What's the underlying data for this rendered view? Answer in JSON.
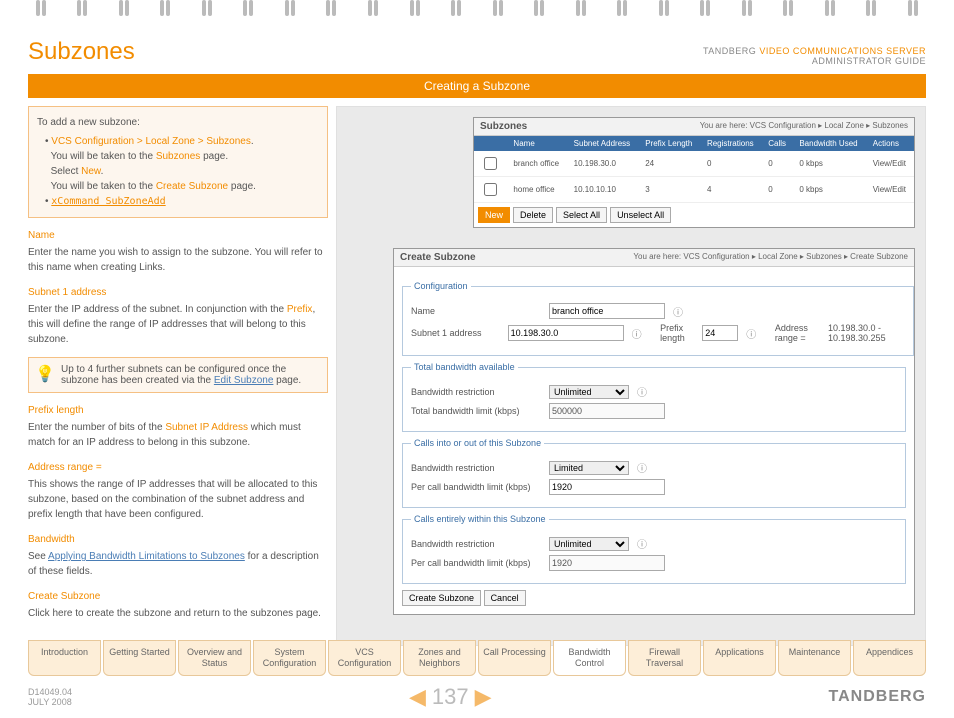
{
  "header": {
    "title": "Subzones",
    "brand": "TANDBERG",
    "product": "VIDEO COMMUNICATIONS SERVER",
    "guide": "ADMINISTRATOR GUIDE",
    "bar": "Creating a Subzone"
  },
  "intro": {
    "lead": "To add a new subzone:",
    "nav": "VCS Configuration > Local Zone > Subzones",
    "l1": "You will be taken to the ",
    "l1o": "Subzones",
    "l1b": " page.",
    "l2": "Select ",
    "l2o": "New",
    "l2b": ".",
    "l3": "You will be taken to the ",
    "l3o": "Create Subzone",
    "l3b": " page.",
    "cmd": "xCommand SubZoneAdd"
  },
  "name": {
    "t": "Name",
    "d": "Enter the name you wish to assign to the subzone.  You will refer to this name when creating Links."
  },
  "sub1": {
    "t": "Subnet 1 address",
    "d1": "Enter the IP address of the subnet.  In conjunction with the ",
    "link": "Prefix",
    "d2": ", this will define the range of IP addresses that will belong to this subzone."
  },
  "tip": {
    "d1": "Up to 4 further subnets can be configured once the subzone has been created via the ",
    "link": "Edit Subzone",
    "d2": " page."
  },
  "prefix": {
    "t": "Prefix length",
    "d1": "Enter the number of bits of the ",
    "link": "Subnet IP Address",
    "d2": " which must match for an IP address to belong in this subzone."
  },
  "range": {
    "t": "Address range =",
    "d": "This shows the range of IP addresses that will be allocated to this subzone, based on the combination of the subnet address and prefix length that have been configured."
  },
  "bw": {
    "t": "Bandwidth",
    "d1": "See ",
    "link": "Applying Bandwidth Limitations to Subzones",
    "d2": " for a description of these fields."
  },
  "create": {
    "t": "Create Subzone",
    "d": "Click here to create the subzone and return to the subzones page."
  },
  "listPanel": {
    "title": "Subzones",
    "crumb": "You are here: VCS Configuration ▸ Local Zone ▸ Subzones",
    "cols": [
      "Name",
      "Subnet Address",
      "Prefix Length",
      "Registrations",
      "Calls",
      "Bandwidth Used",
      "Actions"
    ],
    "rows": [
      {
        "name": "branch office",
        "subnet": "10.198.30.0",
        "prefix": "24",
        "reg": "0",
        "calls": "0",
        "bw": "0 kbps",
        "act": "View/Edit"
      },
      {
        "name": "home office",
        "subnet": "10.10.10.10",
        "prefix": "3",
        "reg": "4",
        "calls": "0",
        "bw": "0 kbps",
        "act": "View/Edit"
      }
    ],
    "btns": {
      "new": "New",
      "del": "Delete",
      "sel": "Select All",
      "unsel": "Unselect All"
    }
  },
  "formPanel": {
    "title": "Create Subzone",
    "crumb": "You are here: VCS Configuration ▸ Local Zone ▸ Subzones ▸ Create Subzone",
    "fs1": "Configuration",
    "nameLbl": "Name",
    "nameVal": "branch office",
    "sub1Lbl": "Subnet 1 address",
    "sub1Val": "10.198.30.0",
    "prefLbl": "Prefix length",
    "prefVal": "24",
    "rangeLbl": "Address range =",
    "rangeVal": "10.198.30.0 - 10.198.30.255",
    "fs2": "Total bandwidth available",
    "bwr": "Bandwidth restriction",
    "unl": "Unlimited",
    "tbl": "Total bandwidth limit (kbps)",
    "tbv": "500000",
    "fs3": "Calls into or out of this Subzone",
    "lim": "Limited",
    "pcl": "Per call bandwidth limit (kbps)",
    "pcv": "1920",
    "fs4": "Calls entirely within this Subzone",
    "create": "Create Subzone",
    "cancel": "Cancel"
  },
  "tabs": [
    "Introduction",
    "Getting Started",
    "Overview and Status",
    "System Configuration",
    "VCS Configuration",
    "Zones and Neighbors",
    "Call Processing",
    "Bandwidth Control",
    "Firewall Traversal",
    "Applications",
    "Maintenance",
    "Appendices"
  ],
  "foot": {
    "doc": "D14049.04",
    "date": "JULY 2008",
    "page": "137",
    "logo": "TANDBERG"
  }
}
